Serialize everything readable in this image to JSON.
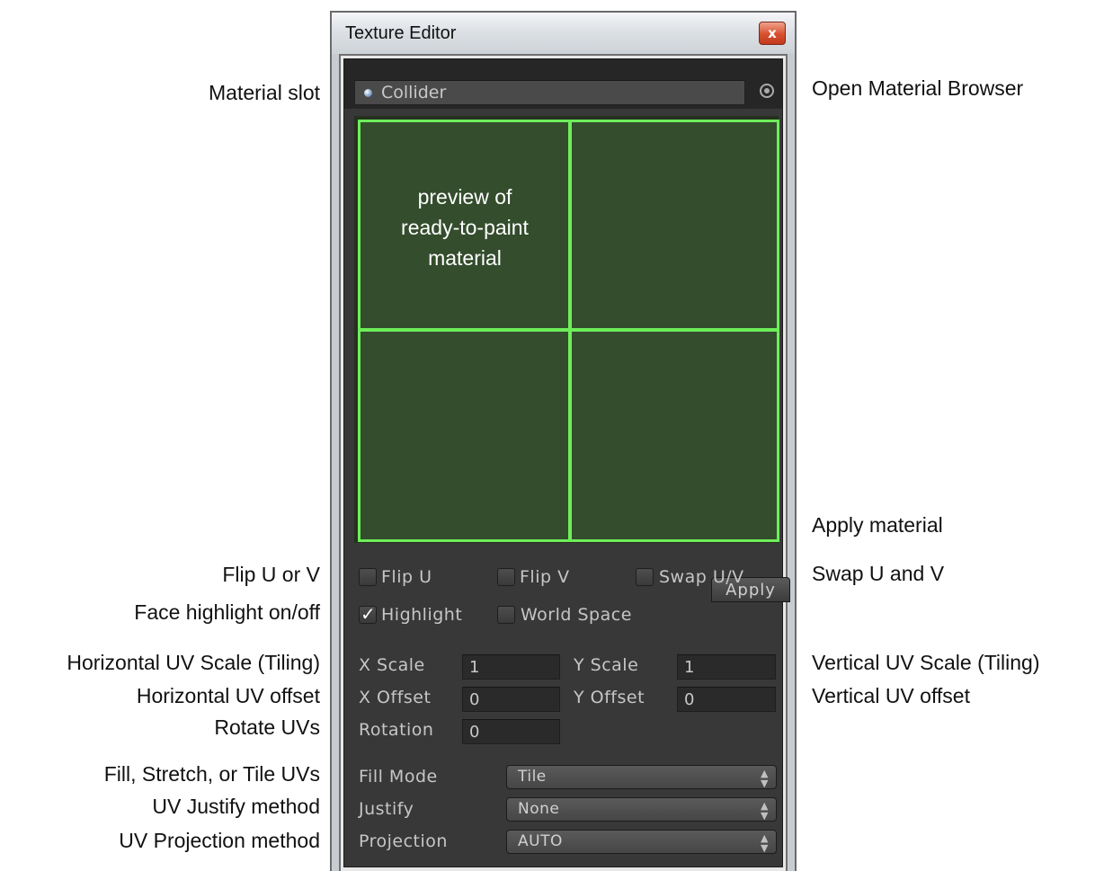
{
  "window": {
    "title": "Texture Editor",
    "close_glyph": "x"
  },
  "material": {
    "slot_value": "Collider",
    "picker_icon": "target-circle-icon"
  },
  "preview": {
    "lines": [
      "preview of",
      "ready-to-paint",
      "material"
    ],
    "grid_color": "#6dee5a",
    "fill_color": "#344d2d"
  },
  "apply_label": "Apply",
  "checkboxes": {
    "flip_u": {
      "label": "Flip U",
      "checked": false
    },
    "flip_v": {
      "label": "Flip V",
      "checked": false
    },
    "swap_uv": {
      "label": "Swap U/V",
      "checked": false
    },
    "highlight": {
      "label": "Highlight",
      "checked": true
    },
    "world_space": {
      "label": "World Space",
      "checked": false
    }
  },
  "fields": {
    "x_scale": {
      "label": "X Scale",
      "value": "1"
    },
    "y_scale": {
      "label": "Y Scale",
      "value": "1"
    },
    "x_offset": {
      "label": "X Offset",
      "value": "0"
    },
    "y_offset": {
      "label": "Y Offset",
      "value": "0"
    },
    "rotation": {
      "label": "Rotation",
      "value": "0"
    }
  },
  "dropdowns": {
    "fill_mode": {
      "label": "Fill Mode",
      "value": "Tile"
    },
    "justify": {
      "label": "Justify",
      "value": "None"
    },
    "projection": {
      "label": "Projection",
      "value": "AUTO"
    }
  },
  "annotations": {
    "left": {
      "material_slot": "Material slot",
      "flip": "Flip U or V",
      "highlight": "Face highlight on/off",
      "h_scale": "Horizontal UV Scale (Tiling)",
      "h_offset": "Horizontal UV offset",
      "rotate": "Rotate UVs",
      "fill": "Fill, Stretch, or Tile UVs",
      "justify": "UV Justify method",
      "projection": "UV Projection method"
    },
    "right": {
      "browser": "Open Material Browser",
      "apply": "Apply material",
      "swap": "Swap U and V",
      "v_scale": "Vertical UV Scale (Tiling)",
      "v_offset": "Vertical UV offset"
    }
  }
}
